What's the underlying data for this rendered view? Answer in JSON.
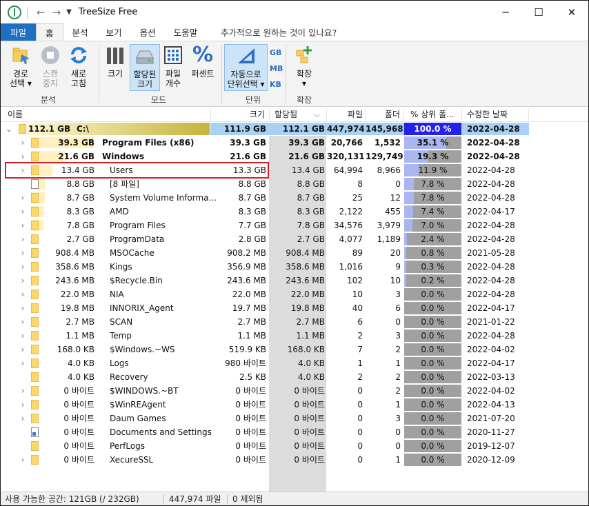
{
  "titlebar": {
    "title": "TreeSize Free",
    "minimize": "─",
    "maximize": "☐",
    "close": "✕"
  },
  "ribbon_tabs": [
    {
      "label": "파일",
      "kind": "file"
    },
    {
      "label": "홈",
      "kind": "selected"
    },
    {
      "label": "분석",
      "kind": "normal"
    },
    {
      "label": "보기",
      "kind": "normal"
    },
    {
      "label": "옵션",
      "kind": "normal"
    },
    {
      "label": "도움말",
      "kind": "normal"
    },
    {
      "label": "추가적으로 원하는 것이 있나요?",
      "kind": "tell"
    }
  ],
  "ribbon": {
    "path_select": {
      "line1": "경로",
      "line2": "선택 ▾"
    },
    "stop_scan": {
      "line1": "스캔",
      "line2": "중지"
    },
    "refresh": {
      "line1": "새로",
      "line2": "고침"
    },
    "group_analysis": "분석",
    "size": {
      "line1": "크기"
    },
    "allocated_size": {
      "line1": "할당된",
      "line2": "크기"
    },
    "file_count": {
      "line1": "파일",
      "line2": "개수"
    },
    "percent": {
      "line1": "퍼센트"
    },
    "group_mode": "모드",
    "auto_unit": {
      "line1": "자동으로",
      "line2": "단위선택 ▾"
    },
    "unit_gb": "GB",
    "unit_mb": "MB",
    "unit_kb": "KB",
    "group_unit": "단위",
    "expand": {
      "line1": "확장",
      "line2": "▾"
    },
    "group_expand": "확장"
  },
  "columns": {
    "name": "이름",
    "size": "크기",
    "allocated": "할당됨",
    "allocated_sort": "⌵",
    "files": "파일",
    "folders": "폴더",
    "percent_parent": "% 상위 폴...",
    "modified": "수정한 날짜"
  },
  "rows": [
    {
      "chev": "⌄",
      "icon": "folder",
      "bar": 1.0,
      "bar_size": "112.1 GB",
      "name": "C:\\",
      "size": "111.9 GB",
      "alloc": "112.1 GB",
      "files": "447,974",
      "folders": "145,968",
      "pct": "100.0 %",
      "pct_val": 1.0,
      "date": "2022-04-28",
      "bold": true,
      "root": true
    },
    {
      "chev": "›",
      "icon": "folder",
      "bar": 0.351,
      "bar_size": "39.3 GB",
      "name": "Program Files (x86)",
      "size": "39.3 GB",
      "alloc": "39.3 GB",
      "files": "20,766",
      "folders": "1,532",
      "pct": "35.1 %",
      "pct_val": 0.351,
      "date": "2022-04-28",
      "bold": true
    },
    {
      "chev": "›",
      "icon": "folder",
      "bar": 0.193,
      "bar_size": "21.6 GB",
      "name": "Windows",
      "size": "21.6 GB",
      "alloc": "21.6 GB",
      "files": "320,131",
      "folders": "129,749",
      "pct": "19.3 %",
      "pct_val": 0.193,
      "date": "2022-04-28",
      "bold": true
    },
    {
      "chev": "›",
      "icon": "folder",
      "bar": 0.119,
      "bar_size": "13.4 GB",
      "name": "Users",
      "size": "13.3 GB",
      "alloc": "13.4 GB",
      "files": "64,994",
      "folders": "8,966",
      "pct": "11.9 %",
      "pct_val": 0.119,
      "date": "2022-04-28"
    },
    {
      "chev": "",
      "icon": "doc",
      "bar": 0.078,
      "bar_size": "8.8 GB",
      "name": "[8 파일]",
      "size": "8.8 GB",
      "alloc": "8.8 GB",
      "files": "8",
      "folders": "0",
      "pct": "7.8 %",
      "pct_val": 0.078,
      "date": "2022-04-28"
    },
    {
      "chev": "›",
      "icon": "folder",
      "bar": 0.078,
      "bar_size": "8.7 GB",
      "name": "System Volume Informa...",
      "size": "8.7 GB",
      "alloc": "8.7 GB",
      "files": "25",
      "folders": "12",
      "pct": "7.8 %",
      "pct_val": 0.078,
      "date": "2022-04-28"
    },
    {
      "chev": "›",
      "icon": "folder",
      "bar": 0.074,
      "bar_size": "8.3 GB",
      "name": "AMD",
      "size": "8.3 GB",
      "alloc": "8.3 GB",
      "files": "2,122",
      "folders": "455",
      "pct": "7.4 %",
      "pct_val": 0.074,
      "date": "2022-04-17"
    },
    {
      "chev": "›",
      "icon": "folder",
      "bar": 0.07,
      "bar_size": "7.8 GB",
      "name": "Program Files",
      "size": "7.7 GB",
      "alloc": "7.8 GB",
      "files": "34,576",
      "folders": "3,979",
      "pct": "7.0 %",
      "pct_val": 0.07,
      "date": "2022-04-28"
    },
    {
      "chev": "›",
      "icon": "folder",
      "bar": 0.024,
      "bar_size": "2.7 GB",
      "name": "ProgramData",
      "size": "2.8 GB",
      "alloc": "2.7 GB",
      "files": "4,077",
      "folders": "1,189",
      "pct": "2.4 %",
      "pct_val": 0.024,
      "date": "2022-04-28"
    },
    {
      "chev": "›",
      "icon": "folder",
      "bar": 0.008,
      "bar_size": "908.4 MB",
      "name": "MSOCache",
      "size": "908.2 MB",
      "alloc": "908.4 MB",
      "files": "89",
      "folders": "20",
      "pct": "0.8 %",
      "pct_val": 0.008,
      "date": "2021-05-28"
    },
    {
      "chev": "›",
      "icon": "folder",
      "bar": 0.003,
      "bar_size": "358.6 MB",
      "name": "Kings",
      "size": "356.9 MB",
      "alloc": "358.6 MB",
      "files": "1,016",
      "folders": "9",
      "pct": "0.3 %",
      "pct_val": 0.003,
      "date": "2022-04-28"
    },
    {
      "chev": "›",
      "icon": "folder",
      "bar": 0.002,
      "bar_size": "243.6 MB",
      "name": "$Recycle.Bin",
      "size": "243.6 MB",
      "alloc": "243.6 MB",
      "files": "102",
      "folders": "10",
      "pct": "0.2 %",
      "pct_val": 0.002,
      "date": "2022-04-28"
    },
    {
      "chev": "›",
      "icon": "folder",
      "bar": 0.0,
      "bar_size": "22.0 MB",
      "name": "NIA",
      "size": "22.0 MB",
      "alloc": "22.0 MB",
      "files": "10",
      "folders": "3",
      "pct": "0.0 %",
      "pct_val": 0.0,
      "date": "2022-04-28"
    },
    {
      "chev": "›",
      "icon": "folder",
      "bar": 0.0,
      "bar_size": "19.8 MB",
      "name": "INNORIX_Agent",
      "size": "19.7 MB",
      "alloc": "19.8 MB",
      "files": "40",
      "folders": "6",
      "pct": "0.0 %",
      "pct_val": 0.0,
      "date": "2022-04-17"
    },
    {
      "chev": "›",
      "icon": "folder",
      "bar": 0.0,
      "bar_size": "2.7 MB",
      "name": "SCAN",
      "size": "2.7 MB",
      "alloc": "2.7 MB",
      "files": "6",
      "folders": "0",
      "pct": "0.0 %",
      "pct_val": 0.0,
      "date": "2021-01-22"
    },
    {
      "chev": "›",
      "icon": "folder",
      "bar": 0.0,
      "bar_size": "1.1 MB",
      "name": "Temp",
      "size": "1.1 MB",
      "alloc": "1.1 MB",
      "files": "2",
      "folders": "3",
      "pct": "0.0 %",
      "pct_val": 0.0,
      "date": "2022-04-28"
    },
    {
      "chev": "›",
      "icon": "folder",
      "bar": 0.0,
      "bar_size": "168.0 KB",
      "name": "$Windows.~WS",
      "size": "519.9 KB",
      "alloc": "168.0 KB",
      "files": "7",
      "folders": "2",
      "pct": "0.0 %",
      "pct_val": 0.0,
      "date": "2022-04-02"
    },
    {
      "chev": "›",
      "icon": "folder",
      "bar": 0.0,
      "bar_size": "4.0 KB",
      "name": "Logs",
      "size": "980 바이트",
      "alloc": "4.0 KB",
      "files": "1",
      "folders": "1",
      "pct": "0.0 %",
      "pct_val": 0.0,
      "date": "2022-04-17"
    },
    {
      "chev": "",
      "icon": "folder",
      "bar": 0.0,
      "bar_size": "4.0 KB",
      "name": "Recovery",
      "size": "2.5 KB",
      "alloc": "4.0 KB",
      "files": "2",
      "folders": "2",
      "pct": "0.0 %",
      "pct_val": 0.0,
      "date": "2022-03-13"
    },
    {
      "chev": "›",
      "icon": "folder",
      "bar": 0.0,
      "bar_size": "0 바이트",
      "name": "$WINDOWS.~BT",
      "size": "0 바이트",
      "alloc": "0 바이트",
      "files": "0",
      "folders": "2",
      "pct": "0.0 %",
      "pct_val": 0.0,
      "date": "2022-04-02"
    },
    {
      "chev": "›",
      "icon": "folder",
      "bar": 0.0,
      "bar_size": "0 바이트",
      "name": "$WinREAgent",
      "size": "0 바이트",
      "alloc": "0 바이트",
      "files": "0",
      "folders": "1",
      "pct": "0.0 %",
      "pct_val": 0.0,
      "date": "2022-04-13"
    },
    {
      "chev": "›",
      "icon": "folder",
      "bar": 0.0,
      "bar_size": "0 바이트",
      "name": "Daum Games",
      "size": "0 바이트",
      "alloc": "0 바이트",
      "files": "0",
      "folders": "3",
      "pct": "0.0 %",
      "pct_val": 0.0,
      "date": "2021-07-20"
    },
    {
      "chev": "",
      "icon": "link",
      "bar": 0.0,
      "bar_size": "0 바이트",
      "name": "Documents and Settings",
      "size": "0 바이트",
      "alloc": "0 바이트",
      "files": "0",
      "folders": "0",
      "pct": "0.0 %",
      "pct_val": 0.0,
      "date": "2020-11-27"
    },
    {
      "chev": "",
      "icon": "folder",
      "bar": 0.0,
      "bar_size": "0 바이트",
      "name": "PerfLogs",
      "size": "0 바이트",
      "alloc": "0 바이트",
      "files": "0",
      "folders": "0",
      "pct": "0.0 %",
      "pct_val": 0.0,
      "date": "2019-12-07"
    },
    {
      "chev": "›",
      "icon": "folder",
      "bar": 0.0,
      "bar_size": "0 바이트",
      "name": "XecureSSL",
      "size": "0 바이트",
      "alloc": "0 바이트",
      "files": "0",
      "folders": "1",
      "pct": "0.0 %",
      "pct_val": 0.0,
      "date": "2020-12-09"
    }
  ],
  "status": {
    "free_space": "사용 가능한 공간: 121GB  (/ 232GB)",
    "files": "447,974 파일",
    "excluded": "0 제외됨"
  },
  "colors": {
    "accent": "#1f6fc5",
    "highlight": "#d62121",
    "pct_fill": "#aab6f2",
    "root_pct": "#2323ec"
  }
}
